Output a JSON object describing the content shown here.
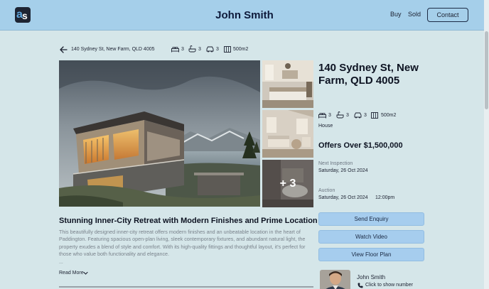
{
  "header": {
    "title": "John Smith",
    "nav": {
      "buy": "Buy",
      "sold": "Sold"
    },
    "contact_label": "Contact",
    "logo_a": "a",
    "logo_s": "s"
  },
  "breadcrumb": {
    "address": "140 Sydney St, New Farm, QLD 4005",
    "beds": "3",
    "baths": "3",
    "cars": "3",
    "land": "500m2"
  },
  "gallery": {
    "more_label": "+ 3"
  },
  "details": {
    "title": "140 Sydney St, New Farm, QLD 4005",
    "beds": "3",
    "baths": "3",
    "cars": "3",
    "land": "500m2",
    "property_type": "House",
    "price": "Offers Over $1,500,000",
    "next_inspection_label": "Next Inspection",
    "next_inspection_date": "Saturday, 26 Oct 2024",
    "auction_label": "Auction",
    "auction_date": "Saturday, 26 Oct 2024",
    "auction_time": "12:00pm"
  },
  "actions": {
    "enquiry": "Send Enquiry",
    "video": "Watch Video",
    "floor_plan": "View Floor Plan"
  },
  "agent": {
    "name": "John Smith",
    "phone_label": "Click to show number"
  },
  "description": {
    "heading": "Stunning Inner-City Retreat with Modern Finishes and Prime Location",
    "body": "This beautifully designed inner-city retreat offers modern finishes and an unbeatable location in the heart of Paddington. Featuring spacious open-plan living, sleek contemporary fixtures, and abundant natural light, the property exudes a blend of style and comfort. With its high-quality fittings and thoughtful layout, it's perfect for those who value both functionality and elegance.",
    "ellipsis": "...",
    "read_more": "Read More"
  },
  "colors": {
    "page_bg": "#d5e6e9",
    "header_bg": "#a5cfea",
    "button_bg": "#a6cdee"
  },
  "icons": [
    "logo",
    "back-arrow-icon",
    "bed-icon",
    "bath-icon",
    "car-icon",
    "land-icon",
    "phone-icon",
    "chevron-down-icon"
  ]
}
